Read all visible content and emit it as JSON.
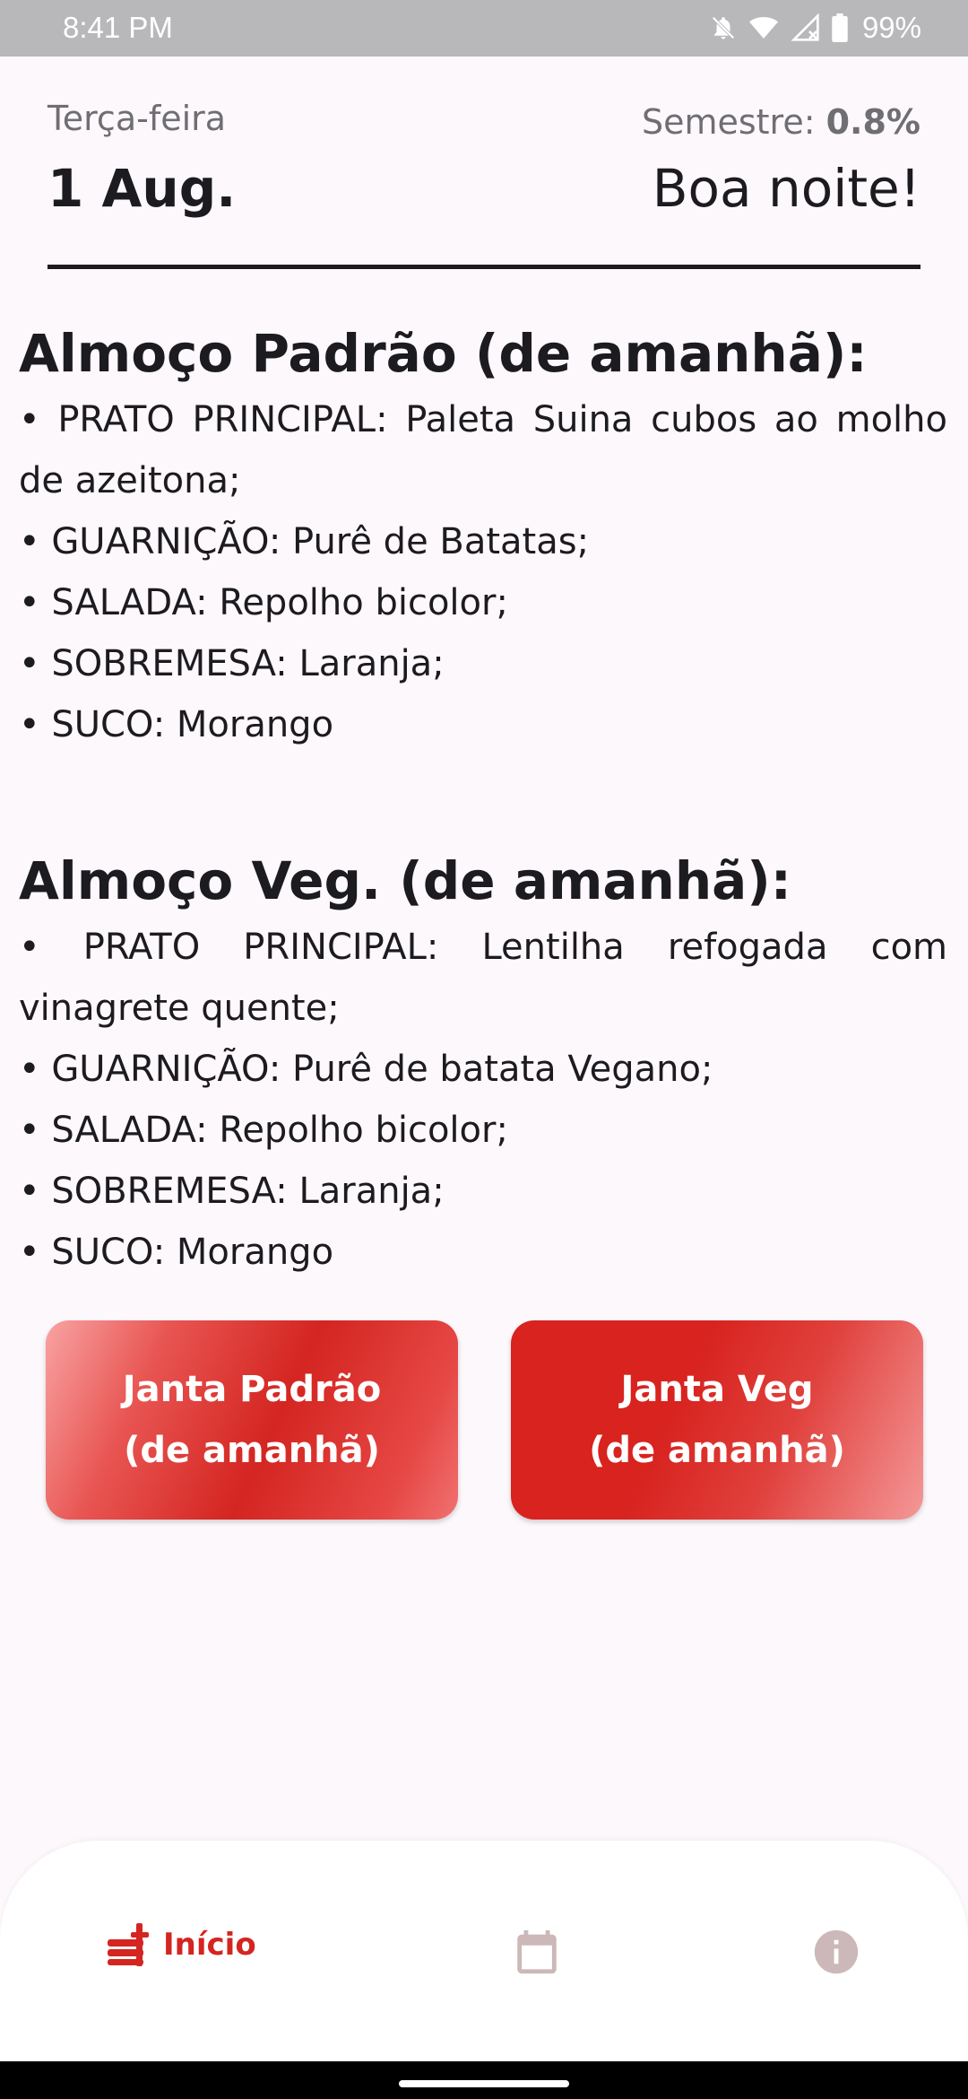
{
  "status_bar": {
    "time": "8:41 PM",
    "battery": "99%",
    "icons": [
      "bell-off-icon",
      "wifi-icon",
      "signal-icon",
      "battery-icon"
    ]
  },
  "header": {
    "weekday": "Terça-feira",
    "date": "1 Aug.",
    "semester_label": "Semestre: ",
    "semester_value": "0.8%",
    "greeting": "Boa noite!"
  },
  "menus": {
    "standard": {
      "title": "Almoço Padrão (de amanhã):",
      "items": [
        "PRATO PRINCIPAL: Paleta Suina cubos ao molho de azeitona;",
        "GUARNIÇÃO: Purê de Batatas;",
        "SALADA: Repolho bicolor;",
        "SOBREMESA: Laranja;",
        "SUCO: Morango"
      ]
    },
    "vegetarian": {
      "title": "Almoço Veg. (de amanhã):",
      "items": [
        "PRATO PRINCIPAL: Lentilha refogada com vinagrete quente;",
        "GUARNIÇÃO: Purê de batata Vegano;",
        "SALADA: Repolho bicolor;",
        "SOBREMESA: Laranja;",
        "SUCO: Morango"
      ]
    }
  },
  "buttons": {
    "dinner_standard": {
      "line1": "Janta Padrão",
      "line2": "(de amanhã)"
    },
    "dinner_veg": {
      "line1": "Janta Veg",
      "line2": "(de amanhã)"
    }
  },
  "bottom_nav": {
    "home_label": "Início",
    "icons": [
      "food-tray-icon",
      "calendar-icon",
      "info-icon"
    ]
  },
  "colors": {
    "accent": "#d42521",
    "background": "#fdf8fc",
    "nav_inactive": "#ccb8b8"
  }
}
